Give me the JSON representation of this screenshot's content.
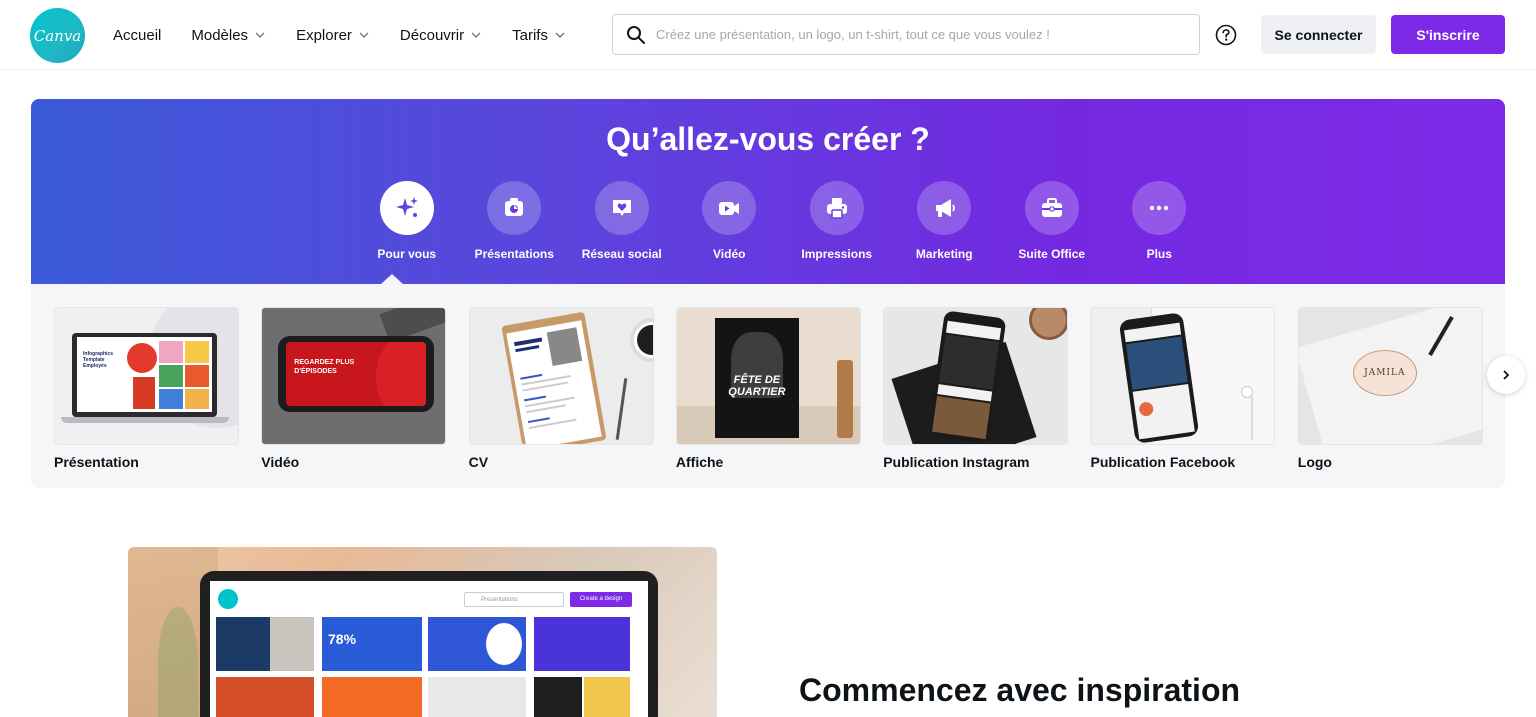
{
  "header": {
    "logo_text": "Canva",
    "nav": [
      {
        "label": "Accueil",
        "dropdown": false
      },
      {
        "label": "Modèles",
        "dropdown": true
      },
      {
        "label": "Explorer",
        "dropdown": true
      },
      {
        "label": "Découvrir",
        "dropdown": true
      },
      {
        "label": "Tarifs",
        "dropdown": true
      }
    ],
    "search_placeholder": "Créez une présentation, un logo, un t-shirt, tout ce que vous voulez !",
    "login_label": "Se connecter",
    "signup_label": "S'inscrire"
  },
  "hero": {
    "title": "Qu’allez-vous créer ?",
    "categories": [
      {
        "label": "Pour vous",
        "icon": "sparkle-icon",
        "active": true
      },
      {
        "label": "Présentations",
        "icon": "presentation-icon",
        "active": false
      },
      {
        "label": "Réseau social",
        "icon": "heart-message-icon",
        "active": false
      },
      {
        "label": "Vidéo",
        "icon": "video-camera-icon",
        "active": false
      },
      {
        "label": "Impressions",
        "icon": "printer-icon",
        "active": false
      },
      {
        "label": "Marketing",
        "icon": "megaphone-icon",
        "active": false
      },
      {
        "label": "Suite Office",
        "icon": "briefcase-icon",
        "active": false
      },
      {
        "label": "Plus",
        "icon": "more-dots-icon",
        "active": false
      }
    ],
    "cards": [
      {
        "label": "Présentation"
      },
      {
        "label": "Vidéo"
      },
      {
        "label": "CV"
      },
      {
        "label": "Affiche"
      },
      {
        "label": "Publication Instagram"
      },
      {
        "label": "Publication Facebook"
      },
      {
        "label": "Logo"
      }
    ],
    "thumb_texts": {
      "presentation": "Infographics Template Employés",
      "video": "REGARDEZ PLUS D'ÉPISODES",
      "affiche": "FÊTE DE QUARTIER",
      "logo": "JAMILA"
    }
  },
  "inspiration": {
    "title": "Commencez avec inspiration",
    "screen_search": "Presentations",
    "screen_button": "Create a design",
    "screen_stat": "78%"
  },
  "colors": {
    "brand_purple": "#7d2ae8",
    "brand_blue": "#3a5ad8",
    "logo_teal": "#00c4cc"
  }
}
